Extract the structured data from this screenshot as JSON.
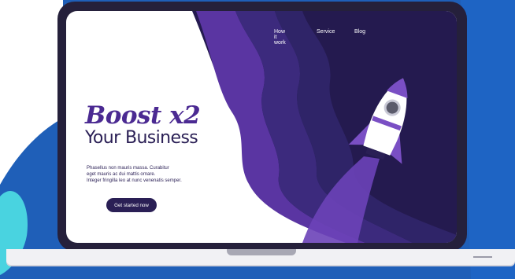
{
  "nav": {
    "how_it_work": "How it work",
    "service": "Service",
    "blog": "Blog"
  },
  "hero": {
    "headline_line1": "Boost x2",
    "headline_line2": "Your Business",
    "description_line1": "Phasellus non mauris massa.  Curabitur",
    "description_line2": "eget mauris ac dui mattis ornare.",
    "description_line3": "Integer fringilla leo at nunc venenatis semper.",
    "cta_label": "Get started now"
  },
  "colors": {
    "background_blue": "#1f5fb8",
    "accent_teal": "#49d3e0",
    "laptop_frame": "#25203b",
    "screen_dark": "#241a4f",
    "purple": "#5a35a2",
    "purple_light": "#7a4fc4",
    "text_dark": "#2a1f55"
  },
  "icons": {
    "hero_illustration": "rocket-icon"
  }
}
